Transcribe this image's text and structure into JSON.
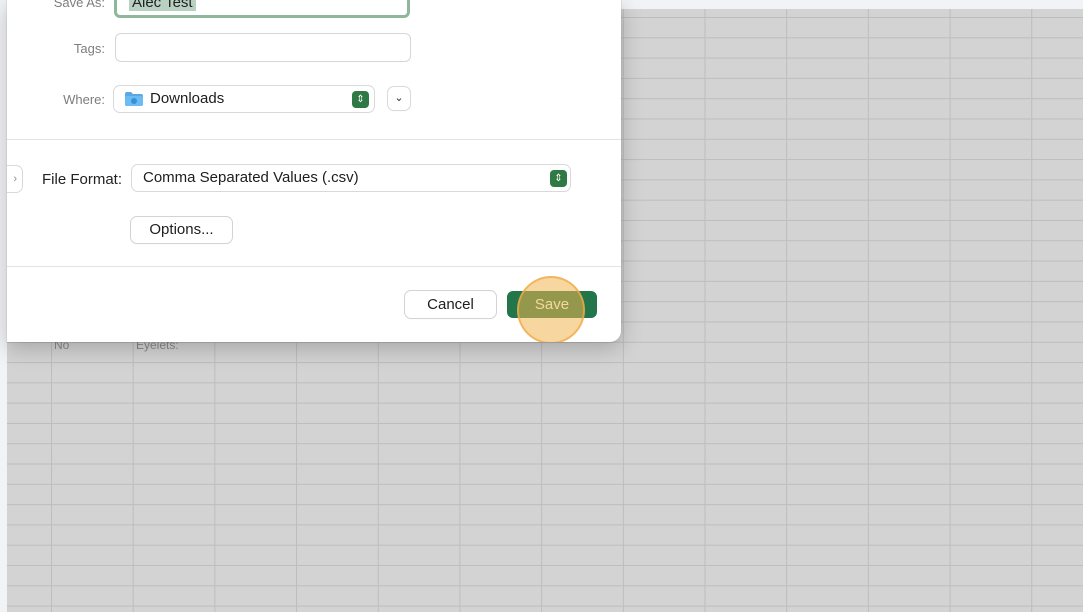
{
  "sheet": {
    "cells": [
      {
        "text": "No"
      },
      {
        "text": "Eyelets:"
      }
    ]
  },
  "dialog": {
    "save_as": {
      "label": "Save As:",
      "value": "Alec Test"
    },
    "tags": {
      "label": "Tags:",
      "value": ""
    },
    "where": {
      "label": "Where:",
      "value": "Downloads",
      "icon": "folder-icon"
    },
    "file_format": {
      "label": "File Format:",
      "value": "Comma Separated Values (.csv)"
    },
    "options_label": "Options...",
    "cancel_label": "Cancel",
    "save_label": "Save"
  },
  "colors": {
    "accent": "#23764a",
    "click_highlight": "#f0b450"
  }
}
